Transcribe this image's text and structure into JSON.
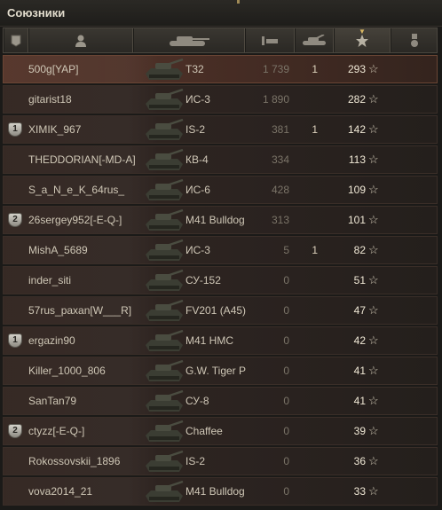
{
  "panel": {
    "title": "Союзники"
  },
  "header": {
    "columns": [
      {
        "name": "squad-column-header",
        "icon": "squad-icon"
      },
      {
        "name": "player-column-header",
        "icon": "player-icon"
      },
      {
        "name": "vehicle-column-header",
        "icon": "tank-icon"
      },
      {
        "name": "damage-column-header",
        "icon": "damage-icon"
      },
      {
        "name": "kills-column-header",
        "icon": "destroyed-tank-icon"
      },
      {
        "name": "score-column-header",
        "icon": "star-icon",
        "sorted": true
      },
      {
        "name": "medal-column-header",
        "icon": "medal-icon"
      }
    ]
  },
  "players": [
    {
      "name": "500g[YAP]",
      "squad": "",
      "vehicle": "T32",
      "damage": "1 739",
      "kills": "1",
      "score": "293",
      "self": true
    },
    {
      "name": "gitarist18",
      "squad": "",
      "vehicle": "ИС-3",
      "damage": "1 890",
      "kills": "",
      "score": "282"
    },
    {
      "name": "XIMIK_967",
      "squad": "1",
      "vehicle": "IS-2",
      "damage": "381",
      "kills": "1",
      "score": "142"
    },
    {
      "name": "THEDDORIAN[-MD-A]",
      "squad": "",
      "vehicle": "КВ-4",
      "damage": "334",
      "kills": "",
      "score": "113"
    },
    {
      "name": "S_a_N_e_K_64rus_",
      "squad": "",
      "vehicle": "ИС-6",
      "damage": "428",
      "kills": "",
      "score": "109"
    },
    {
      "name": "26sergey952[-E-Q-]",
      "squad": "2",
      "vehicle": "M41 Bulldog",
      "damage": "313",
      "kills": "",
      "score": "101"
    },
    {
      "name": "MishA_5689",
      "squad": "",
      "vehicle": "ИС-3",
      "damage": "5",
      "kills": "1",
      "score": "82"
    },
    {
      "name": "inder_siti",
      "squad": "",
      "vehicle": "СУ-152",
      "damage": "0",
      "kills": "",
      "score": "51"
    },
    {
      "name": "57rus_paxan[W___R]",
      "squad": "",
      "vehicle": "FV201 (A45)",
      "damage": "0",
      "kills": "",
      "score": "47"
    },
    {
      "name": "ergazin90",
      "squad": "1",
      "vehicle": "M41 HMC",
      "damage": "0",
      "kills": "",
      "score": "42"
    },
    {
      "name": "Killer_1000_806",
      "squad": "",
      "vehicle": "G.W. Tiger P",
      "damage": "0",
      "kills": "",
      "score": "41"
    },
    {
      "name": "SanTan79",
      "squad": "",
      "vehicle": "СУ-8",
      "damage": "0",
      "kills": "",
      "score": "41"
    },
    {
      "name": "ctyzz[-E-Q-]",
      "squad": "2",
      "vehicle": "Chaffee",
      "damage": "0",
      "kills": "",
      "score": "39"
    },
    {
      "name": "Rokossovskii_1896",
      "squad": "",
      "vehicle": "IS-2",
      "damage": "0",
      "kills": "",
      "score": "36"
    },
    {
      "name": "vova2014_21",
      "squad": "",
      "vehicle": "M41 Bulldog",
      "damage": "0",
      "kills": "",
      "score": "33"
    }
  ],
  "colors": {
    "self_row": "#55352a",
    "row": "#2b2320",
    "accent": "#d8b662"
  }
}
